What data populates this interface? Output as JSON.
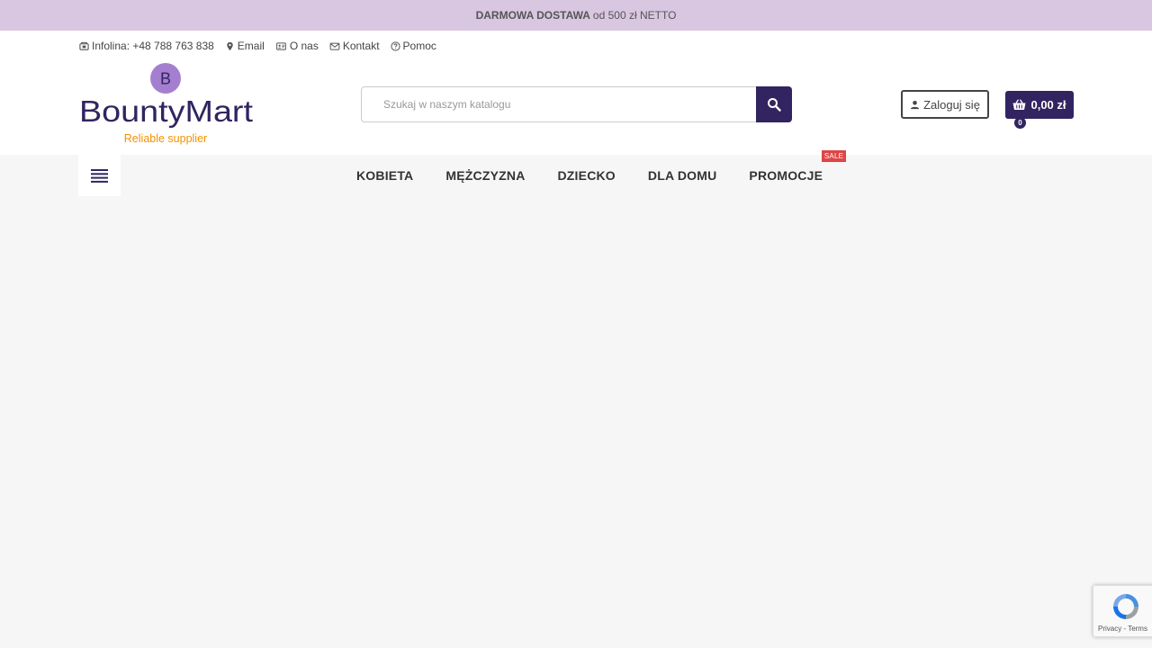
{
  "promo": {
    "bold": "DARMOWA DOSTAWA",
    "text": "od 500 zł NETTO"
  },
  "top_links": [
    {
      "name": "hotline",
      "icon": "phone-icon",
      "label": "Infolina: +48 788 763 838"
    },
    {
      "name": "email",
      "icon": "location-pin-icon",
      "label": "Email"
    },
    {
      "name": "about",
      "icon": "id-card-icon",
      "label": "O nas"
    },
    {
      "name": "contact",
      "icon": "envelope-icon",
      "label": "Kontakt"
    },
    {
      "name": "help",
      "icon": "question-circle-icon",
      "label": "Pomoc"
    }
  ],
  "logo": {
    "brand": "BountyMart",
    "tagline": "Reliable supplier",
    "mark": "B"
  },
  "search": {
    "placeholder": "Szukaj w naszym katalogu"
  },
  "account": {
    "login_label": "Zaloguj się"
  },
  "cart": {
    "total": "0,00 zł",
    "count": "0"
  },
  "nav": {
    "items": [
      "KOBIETA",
      "MĘŻCZYZNA",
      "DZIECKO",
      "DLA DOMU",
      "PROMOCJE"
    ],
    "sale_badge": "SALE"
  },
  "recaptcha": {
    "links": "Privacy - Terms"
  },
  "colors": {
    "brand": "#322460",
    "accent_orange": "#f39200",
    "promo_bg": "#d9c6e1",
    "logo_mark": "#a57fcf",
    "sale": "#e04545"
  }
}
